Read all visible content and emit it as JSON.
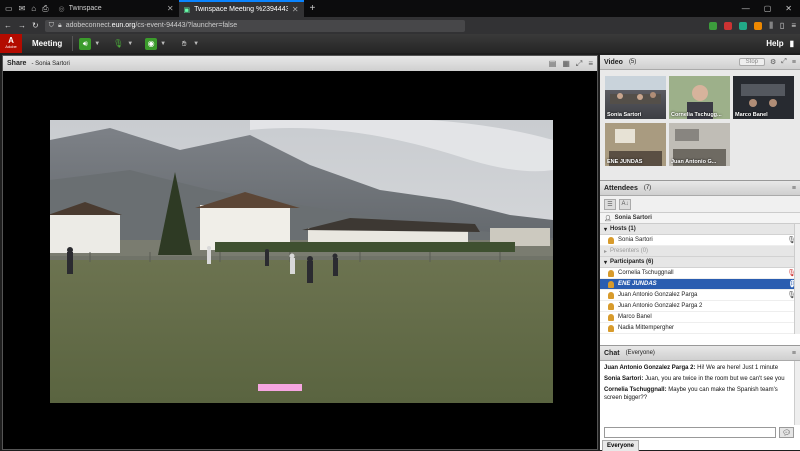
{
  "browser": {
    "tabs": [
      {
        "title": "Twinspace",
        "active": false
      },
      {
        "title": "Twinspace Meeting %2394443",
        "active": true
      }
    ],
    "url_prefix": "adobeconnect.",
    "url_host": "eun.org",
    "url_path": "/cs-event-94443/?launcher=false"
  },
  "menubar": {
    "logo": "Adobe",
    "meeting_label": "Meeting",
    "help_label": "Help"
  },
  "share": {
    "title": "Share",
    "presenter": "- Sonia Sartori"
  },
  "video_pod": {
    "title": "Video",
    "count": "(5)",
    "stop_label": "Stop",
    "thumbs": [
      {
        "name": "Sonia Sartori"
      },
      {
        "name": "Cornelia Tschugg..."
      },
      {
        "name": "Marco Banel"
      },
      {
        "name": "ENE JUNDAS"
      },
      {
        "name": "Juan Antonio G..."
      }
    ]
  },
  "attendees": {
    "title": "Attendees",
    "count": "(7)",
    "me": "Sonia Sartori",
    "hosts_label": "Hosts (1)",
    "hosts": [
      "Sonia Sartori"
    ],
    "presenters_label": "Presenters (0)",
    "participants_label": "Participants (6)",
    "participants": [
      {
        "name": "Cornelia Tschuggnall",
        "selected": false
      },
      {
        "name": "ENE JUNDAS",
        "selected": true
      },
      {
        "name": "Juan Antonio Gonzalez Parga",
        "selected": false
      },
      {
        "name": "Juan Antonio Gonzalez Parga 2",
        "selected": false
      },
      {
        "name": "Marco Banel",
        "selected": false
      },
      {
        "name": "Nadia Mittempergher",
        "selected": false
      }
    ]
  },
  "chat": {
    "title": "Chat",
    "scope": "(Everyone)",
    "messages": [
      {
        "from": "Juan Antonio Gonzalez Parga 2:",
        "text": " Hi! We are here! Just 1 minute"
      },
      {
        "from": "Sonia Sartori:",
        "text": " Juan, you are twice in the room but we can't see you"
      },
      {
        "from": "Cornelia Tschuggnall:",
        "text": " Maybe you can make the Spanish team's screen bigger??"
      }
    ],
    "tab_label": "Everyone"
  },
  "colors": {
    "selection": "#2a5db0",
    "adobe_red": "#b30b00",
    "caption_pink": "#f5a6e0"
  }
}
